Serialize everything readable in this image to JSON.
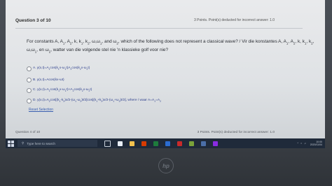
{
  "question": {
    "number_label": "Question 3 of 10",
    "points_label": "3 Points. Point(s) deducted for incorrect answer: 1.0",
    "text_html": "For constants A, A<sub>1</sub>, A<sub>2</sub>, k, k<sub>1</sub>, k<sub>2</sub>, ω,ω<sub>1</sub>, and ω<sub>2</sub>, which of the following does not represent a classical wave? / Vir die konstantes A, A<sub>1</sub>, A<sub>2</sub>, k, k<sub>1</sub>, k<sub>2</sub>, ω,ω<sub>1</sub>, en ω<sub>2</sub>, watter van die volgende stel nie 'n klassieke golf voor nie?"
  },
  "options": [
    {
      "id": "A",
      "label_html": "A. y(x,t)=A<sub>1</sub>cos(k<sub>1</sub>x-ω<sub>1</sub>t)A<sub>2</sub>cos(k<sub>2</sub>x-ω<sub>2</sub>t)"
    },
    {
      "id": "B",
      "label_html": "B. y(x,t)=Acos(kx-ωt)"
    },
    {
      "id": "C",
      "label_html": "C. y(x,t)=A<sub>1</sub>cos(k<sub>1</sub>x-ω<sub>1</sub>t)+A<sub>2</sub>cos(k<sub>2</sub>x-ω<sub>2</sub>t)"
    },
    {
      "id": "D",
      "label_html": "D. y(x,t)=A<sub>2</sub>cos[(k<sub>1</sub>-k<sub>2</sub>)x/2-(ω<sub>1</sub>-ω<sub>2</sub>)t/2]cos[(k<sub>1</sub>+k<sub>2</sub>)x/2-(ω<sub>1</sub>+ω<sub>2</sub>)t/2], where / waar A=A<sub>1</sub>=A<sub>2</sub>"
    }
  ],
  "reset_label": "Reset Selection",
  "next_question": {
    "number_label": "Question 4 of 10",
    "points_label": "3 Points. Point(s) deducted for incorrect answer: 1.0"
  },
  "taskbar": {
    "search_placeholder": "Type here to search",
    "clock_time": "10:00",
    "clock_date": "2020/11/04"
  },
  "colors": {
    "option_text": "#2c3e8c",
    "link": "#3a5fb0",
    "taskbar": "#1f2a3a"
  }
}
